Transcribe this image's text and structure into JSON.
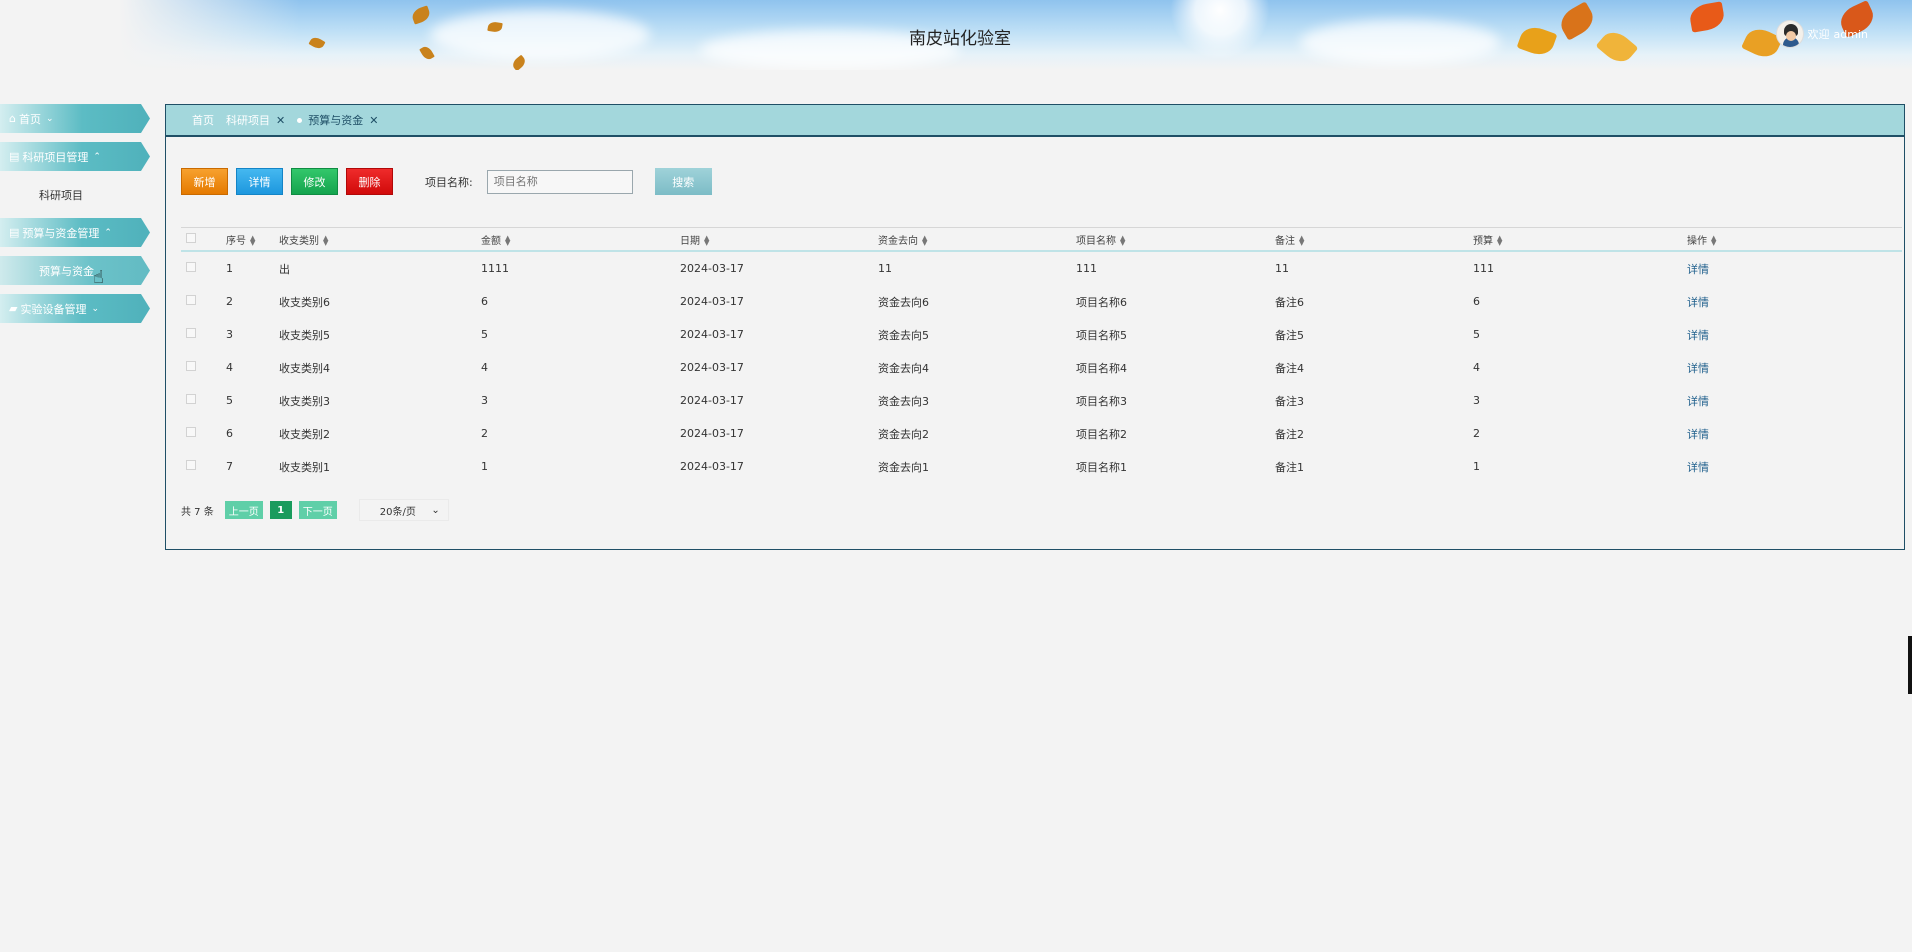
{
  "header": {
    "title": "南皮站化验室",
    "welcome": "欢迎",
    "username": "admin"
  },
  "sidebar": {
    "groups": [
      {
        "icon": "home-icon",
        "label": "首页",
        "chevron": "⌄"
      },
      {
        "icon": "list-icon",
        "label": "科研项目管理",
        "chevron": "⌃"
      },
      {
        "label": "科研项目"
      },
      {
        "icon": "list-icon",
        "label": "预算与资金管理",
        "chevron": "⌃"
      },
      {
        "label": "预算与资金"
      },
      {
        "icon": "car-icon",
        "label": "实验设备管理",
        "chevron": "⌄"
      }
    ]
  },
  "tabs": [
    {
      "label": "首页"
    },
    {
      "label": "科研项目",
      "close": "✕"
    },
    {
      "label": "预算与资金",
      "close": "✕"
    }
  ],
  "toolbar": {
    "add": "新增",
    "detail": "详情",
    "edit": "修改",
    "delete": "删除",
    "search_label": "项目名称:",
    "search_placeholder": "项目名称",
    "search_button": "搜索"
  },
  "table": {
    "columns": [
      "序号",
      "收支类别",
      "金额",
      "日期",
      "资金去向",
      "项目名称",
      "备注",
      "预算",
      "操作"
    ],
    "rows": [
      {
        "idx": "1",
        "type": "出",
        "amount": "1111",
        "date": "2024-03-17",
        "flow": "11",
        "name": "111",
        "note": "11",
        "budget": "111",
        "op": "详情"
      },
      {
        "idx": "2",
        "type": "收支类别6",
        "amount": "6",
        "date": "2024-03-17",
        "flow": "资金去向6",
        "name": "项目名称6",
        "note": "备注6",
        "budget": "6",
        "op": "详情"
      },
      {
        "idx": "3",
        "type": "收支类别5",
        "amount": "5",
        "date": "2024-03-17",
        "flow": "资金去向5",
        "name": "项目名称5",
        "note": "备注5",
        "budget": "5",
        "op": "详情"
      },
      {
        "idx": "4",
        "type": "收支类别4",
        "amount": "4",
        "date": "2024-03-17",
        "flow": "资金去向4",
        "name": "项目名称4",
        "note": "备注4",
        "budget": "4",
        "op": "详情"
      },
      {
        "idx": "5",
        "type": "收支类别3",
        "amount": "3",
        "date": "2024-03-17",
        "flow": "资金去向3",
        "name": "项目名称3",
        "note": "备注3",
        "budget": "3",
        "op": "详情"
      },
      {
        "idx": "6",
        "type": "收支类别2",
        "amount": "2",
        "date": "2024-03-17",
        "flow": "资金去向2",
        "name": "项目名称2",
        "note": "备注2",
        "budget": "2",
        "op": "详情"
      },
      {
        "idx": "7",
        "type": "收支类别1",
        "amount": "1",
        "date": "2024-03-17",
        "flow": "资金去向1",
        "name": "项目名称1",
        "note": "备注1",
        "budget": "1",
        "op": "详情"
      }
    ]
  },
  "pagination": {
    "total": "共 7 条",
    "prev": "上一页",
    "page": "1",
    "next": "下一页",
    "page_size": "20条/页"
  },
  "colors": {
    "accent": "#5cbcc4",
    "tabbar": "#a3d7dc",
    "border": "#1f4f66"
  }
}
